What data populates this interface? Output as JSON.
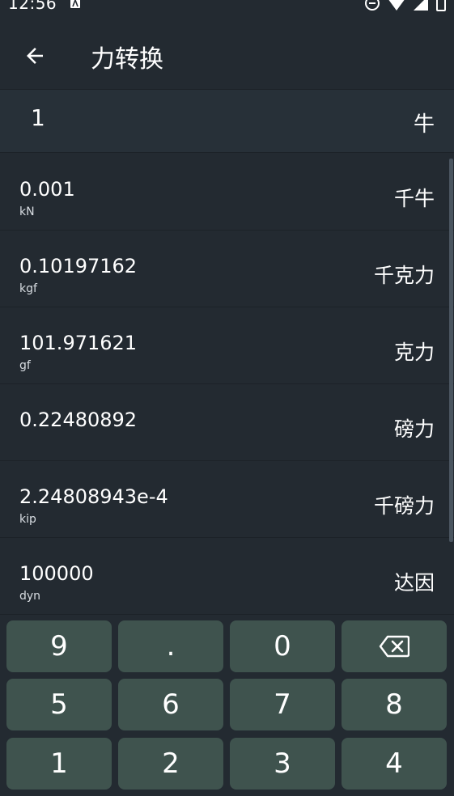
{
  "status_bar": {
    "time": "12:56"
  },
  "app_bar": {
    "title": "力转换"
  },
  "input": {
    "value": "1",
    "unit": "牛"
  },
  "results": [
    {
      "value": "0.001",
      "symbol": "kN",
      "unit": "千牛"
    },
    {
      "value": "0.10197162",
      "symbol": "kgf",
      "unit": "千克力"
    },
    {
      "value": "101.971621",
      "symbol": "gf",
      "unit": "克力"
    },
    {
      "value": "0.22480892",
      "symbol": "",
      "unit": "磅力"
    },
    {
      "value": "2.24808943e-4",
      "symbol": "kip",
      "unit": "千磅力"
    },
    {
      "value": "100000",
      "symbol": "dyn",
      "unit": "达因"
    }
  ],
  "keypad": {
    "row1": [
      "9",
      ".",
      "0",
      "backspace"
    ],
    "row2": [
      "5",
      "6",
      "7",
      "8"
    ],
    "row3": [
      "1",
      "2",
      "3",
      "4"
    ]
  },
  "colors": {
    "background": "#232a31",
    "key_background": "#3f534e",
    "text": "#ffffff"
  },
  "icons": {
    "back": "arrow-left-icon",
    "backspace": "backspace-icon"
  }
}
